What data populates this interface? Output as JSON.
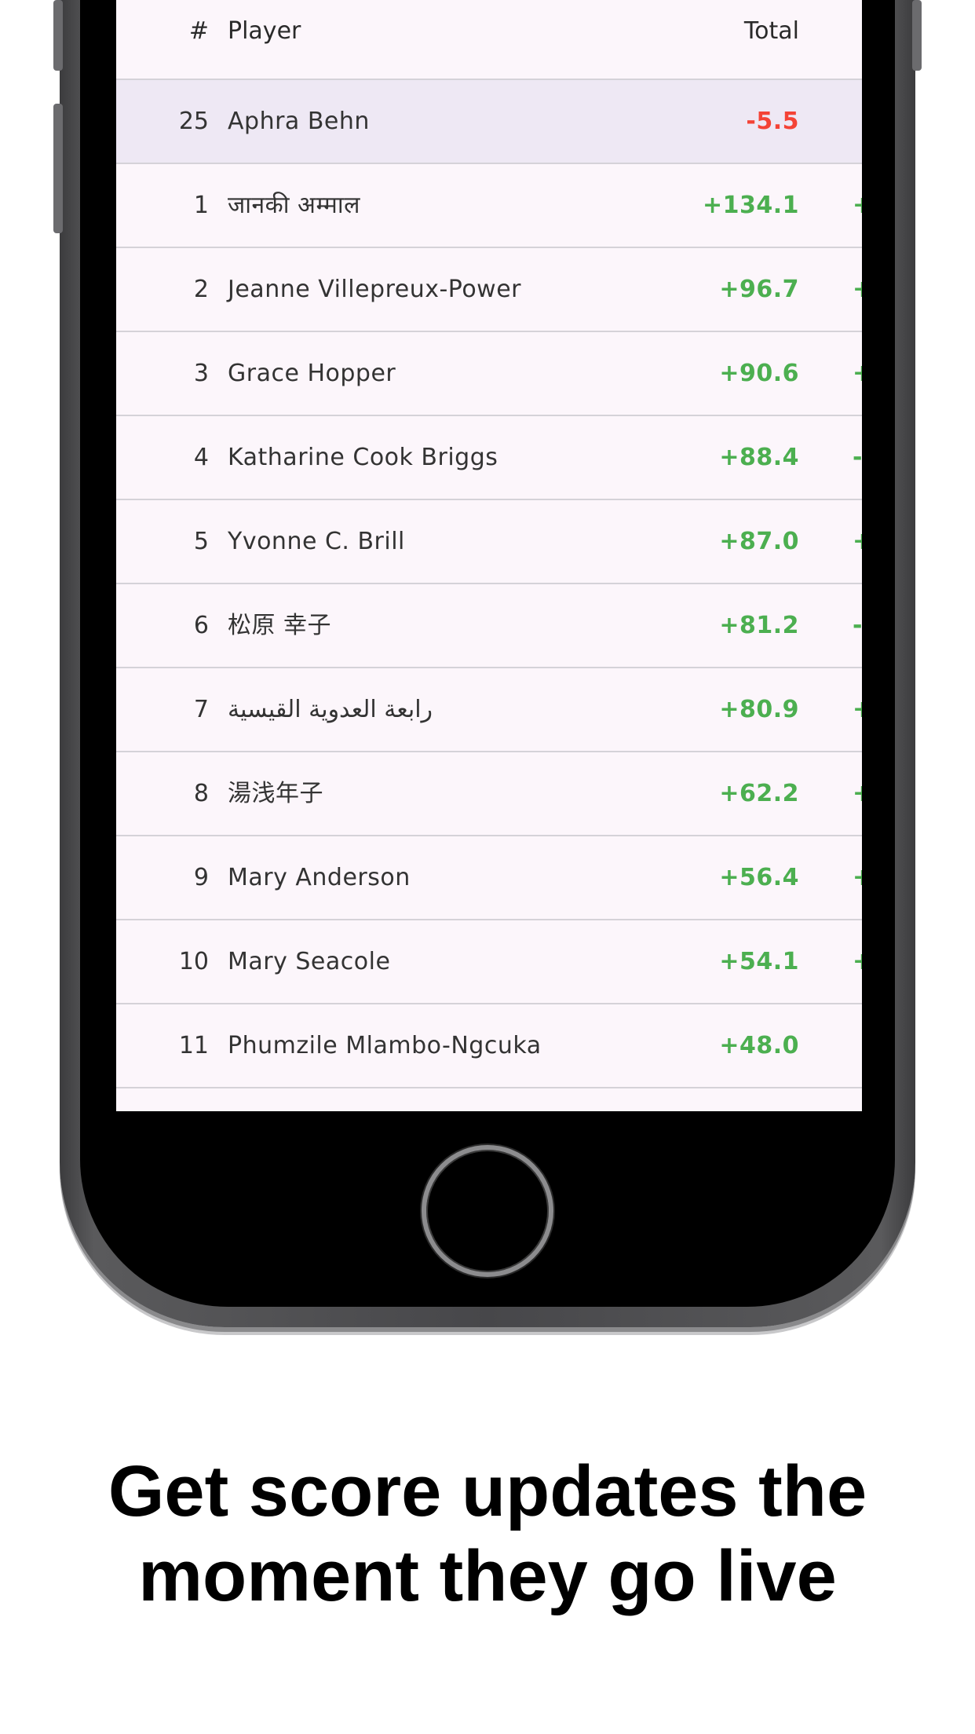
{
  "table": {
    "header": {
      "number": "#",
      "player": "Player",
      "total": "Total"
    },
    "highlighted_row": {
      "rank": "25",
      "name": "Aphra Behn",
      "total": "-5.5"
    },
    "rows": [
      {
        "rank": "1",
        "name": "जानकी अम्माल",
        "total": "+134.1",
        "extra": "+"
      },
      {
        "rank": "2",
        "name": "Jeanne Villepreux-Power",
        "total": "+96.7",
        "extra": "+"
      },
      {
        "rank": "3",
        "name": "Grace Hopper",
        "total": "+90.6",
        "extra": "+"
      },
      {
        "rank": "4",
        "name": "Katharine Cook Briggs",
        "total": "+88.4",
        "extra": "-"
      },
      {
        "rank": "5",
        "name": "Yvonne C. Brill",
        "total": "+87.0",
        "extra": "+"
      },
      {
        "rank": "6",
        "name": "松原 幸子",
        "total": "+81.2",
        "extra": "-"
      },
      {
        "rank": "7",
        "name": "رابعة العدوية القيسية",
        "total": "+80.9",
        "extra": "+"
      },
      {
        "rank": "8",
        "name": "湯浅年子",
        "total": "+62.2",
        "extra": "+"
      },
      {
        "rank": "9",
        "name": "Mary Anderson",
        "total": "+56.4",
        "extra": "+"
      },
      {
        "rank": "10",
        "name": "Mary Seacole",
        "total": "+54.1",
        "extra": "+"
      },
      {
        "rank": "11",
        "name": "Phumzile Mlambo-Ngcuka",
        "total": "+48.0",
        "extra": ""
      }
    ]
  },
  "tagline": {
    "line1": "Get score updates the",
    "line2": "moment they go live"
  },
  "colors": {
    "positive": "#4caf50",
    "negative": "#f44336",
    "highlight_row": "#eee8f4",
    "screen_bg": "#fcf6fb"
  }
}
